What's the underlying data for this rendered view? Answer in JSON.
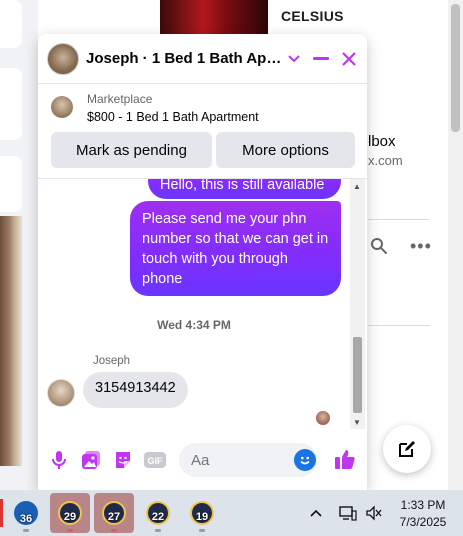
{
  "background": {
    "product_title": "CELSIUS",
    "box_text": "lbox",
    "email_text": "x.com"
  },
  "chat": {
    "title": "Joseph · 1 Bed 1 Bath Apar...",
    "listing": {
      "label": "Marketplace",
      "title": "$800 - 1 Bed 1 Bath Apartment",
      "mark_pending": "Mark as pending",
      "more_options": "More options"
    },
    "messages": {
      "partial_outgoing": "Hello, this is still available",
      "outgoing": "Please send me your phn number so that we can get in touch with you through phone",
      "timestamp": "Wed 4:34 PM",
      "sender": "Joseph",
      "incoming": "3154913442"
    },
    "composer": {
      "placeholder": "Aa",
      "gif_label": "GIF"
    }
  },
  "taskbar": {
    "apps": [
      {
        "label": "36",
        "color": "#1b5fb3"
      },
      {
        "label": "29",
        "color": "#1f2b4a",
        "active": true
      },
      {
        "label": "27",
        "color": "#1f2b4a",
        "active": true
      },
      {
        "label": "22",
        "color": "#1f2b4a"
      },
      {
        "label": "19",
        "color": "#1f2b4a"
      }
    ],
    "time": "1:33 PM",
    "date": "7/3/2025"
  },
  "colors": {
    "messenger_purple": "#8a2bf2",
    "accent_pink": "#c135ee",
    "messenger_blue": "#1b74e4"
  }
}
